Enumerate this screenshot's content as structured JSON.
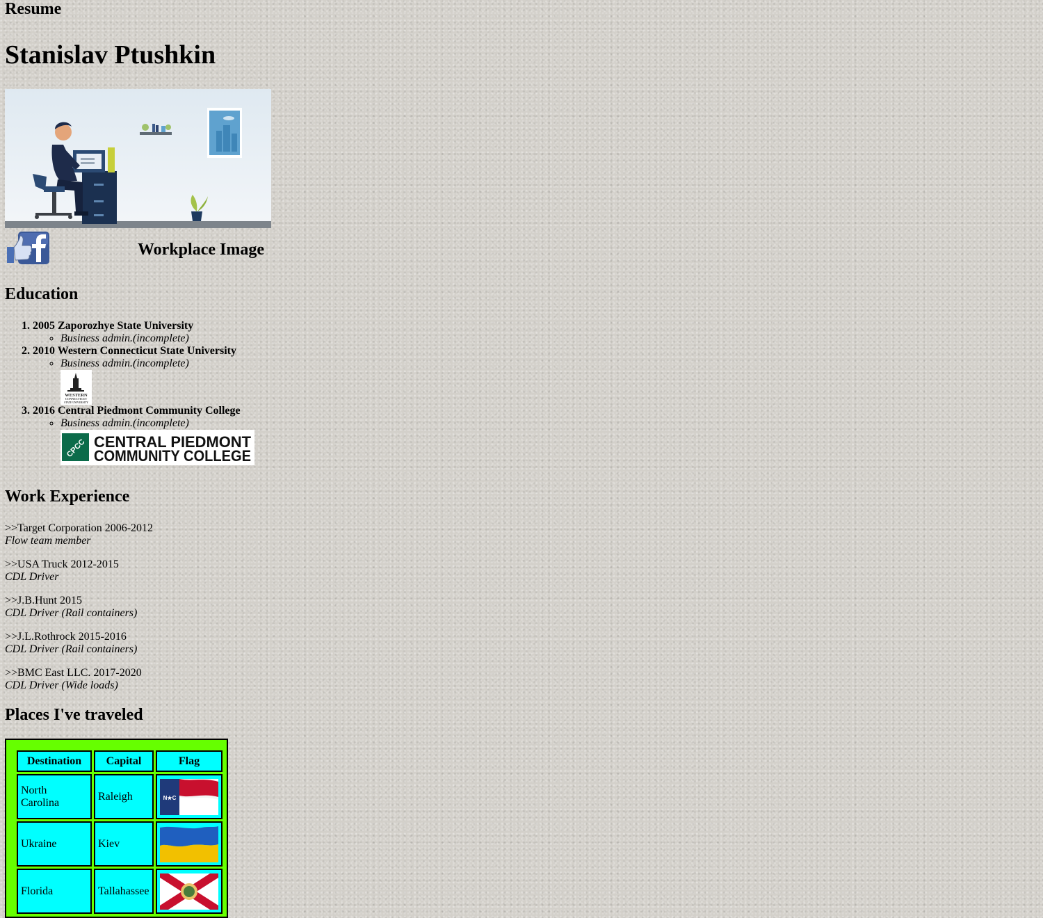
{
  "page": {
    "label": "Resume",
    "name": "Stanislav Ptushkin"
  },
  "hero": {
    "caption": "Workplace Image"
  },
  "education": {
    "heading": "Education",
    "items": [
      {
        "school": "2005 Zaporozhye State University",
        "program": "Business admin.(incomplete)"
      },
      {
        "school": "2010 Western Connecticut State University",
        "program": "Business admin.(incomplete)"
      },
      {
        "school": "2016 Central Piedmont Community College",
        "program": "Business admin.(incomplete)"
      }
    ],
    "logos": {
      "wcsu_text": "WESTERN",
      "wcsu_sub1": "CONNECTICUT",
      "wcsu_sub2": "STATE UNIVERSITY",
      "cpcc_mark": "CPCC",
      "cpcc_line1": "CENTRAL PIEDMONT",
      "cpcc_line2": "COMMUNITY COLLEGE"
    }
  },
  "work": {
    "heading": "Work Experience",
    "items": [
      {
        "company": ">>Target Corporation 2006-2012",
        "role": "Flow team member"
      },
      {
        "company": ">>USA Truck 2012-2015",
        "role": "CDL Driver"
      },
      {
        "company": ">>J.B.Hunt 2015",
        "role": "CDL Driver (Rail containers)"
      },
      {
        "company": ">>J.L.Rothrock 2015-2016",
        "role": "CDL Driver (Rail containers)"
      },
      {
        "company": ">>BMC East LLC. 2017-2020",
        "role": "CDL Driver (Wide loads)"
      }
    ]
  },
  "travel": {
    "heading": "Places I've traveled",
    "columns": [
      "Destination",
      "Capital",
      "Flag"
    ],
    "rows": [
      {
        "destination": "North Carolina",
        "capital": "Raleigh",
        "flag": "north-carolina-flag",
        "flag_text": "N★C"
      },
      {
        "destination": "Ukraine",
        "capital": "Kiev",
        "flag": "ukraine-flag"
      },
      {
        "destination": "Florida",
        "capital": "Tallahassee",
        "flag": "florida-flag"
      }
    ]
  },
  "colors": {
    "table_outer": "#66ff00",
    "table_cell": "#00ffff",
    "cpcc_green": "#0b6b4a",
    "hero_navy": "#1e2b4a"
  }
}
